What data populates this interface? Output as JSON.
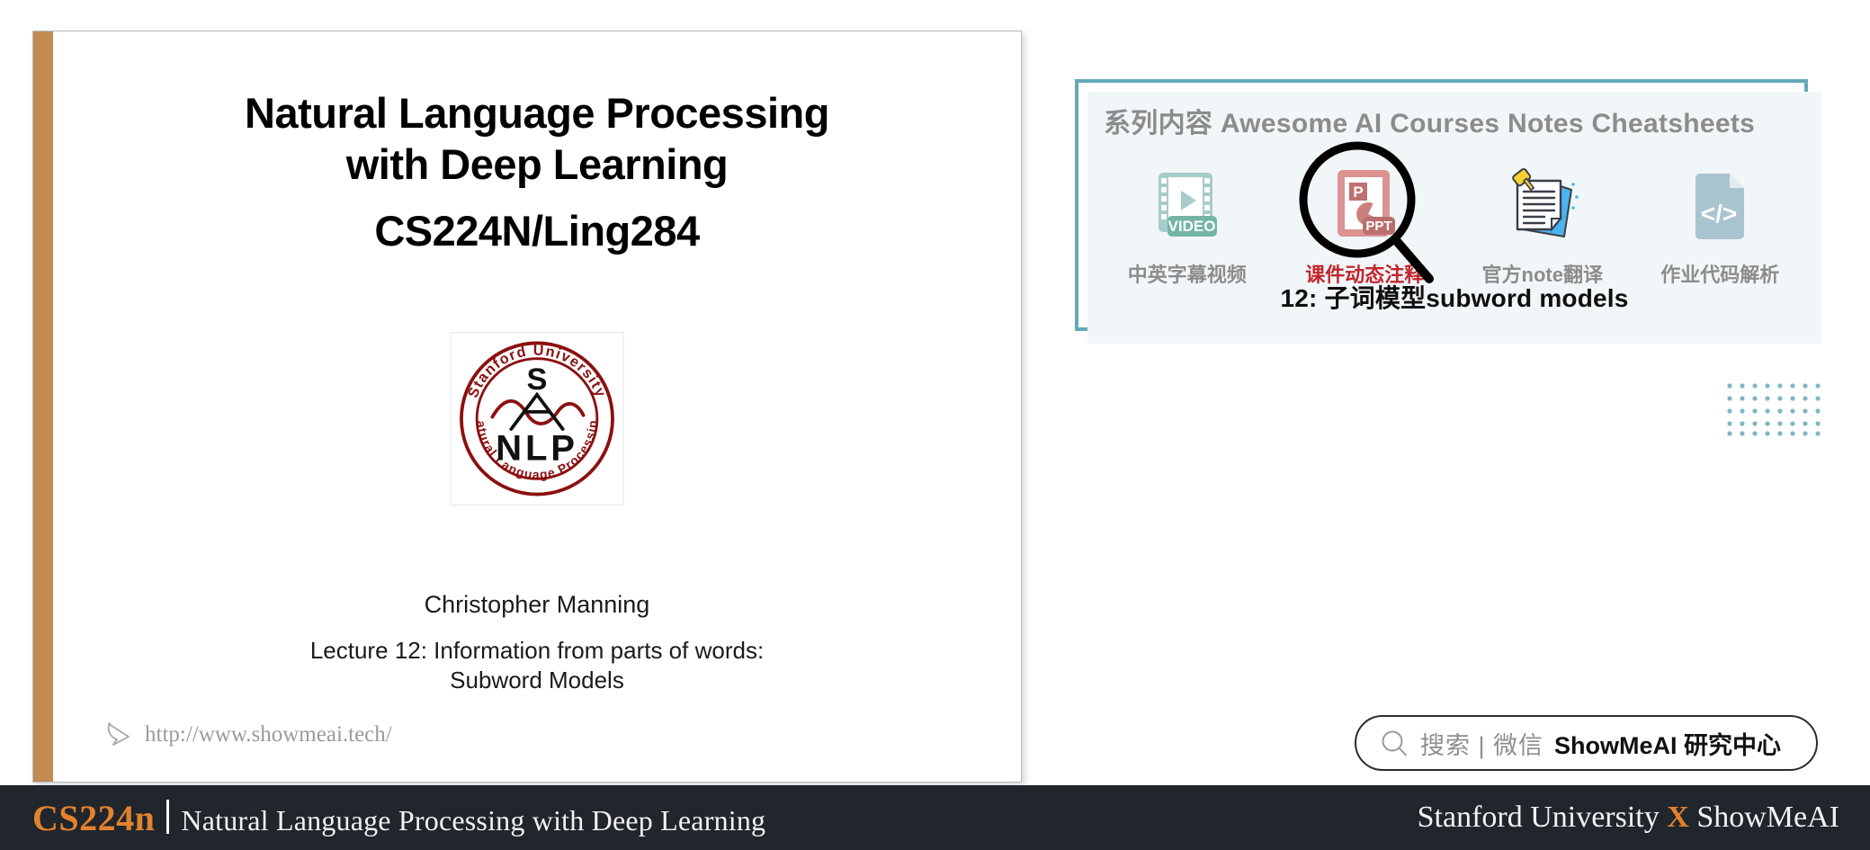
{
  "slide": {
    "title_line1": "Natural Language Processing",
    "title_line2": "with Deep Learning",
    "title_line3": "CS224N/Ling284",
    "logo": {
      "top_arc": "Stanford University",
      "bottom_arc": "Natural Language Processing",
      "letter_s": "S",
      "letters_nlp": "NLP"
    },
    "presenter": "Christopher Manning",
    "lecture_line1": "Lecture 12: Information from parts of words:",
    "lecture_line2": "Subword Models",
    "watermark_url": "http://www.showmeai.tech/",
    "accent_color": "#c38a51"
  },
  "promo": {
    "header": "系列内容 Awesome AI Courses Notes Cheatsheets",
    "border_color": "#62aab8",
    "background_color": "#f1f6f9",
    "items": [
      {
        "label": "中英字幕视频",
        "icon": "video-film-icon",
        "highlighted": false
      },
      {
        "label": "课件动态注释",
        "icon": "ppt-magnifier-icon",
        "highlighted": true
      },
      {
        "label": "官方note翻译",
        "icon": "pinned-note-icon",
        "highlighted": false
      },
      {
        "label": "作业代码解析",
        "icon": "code-file-icon",
        "highlighted": false
      }
    ],
    "icon_badge_video": "VIDEO",
    "icon_badge_ppt": "PPT",
    "icon_letter_ppt": "P",
    "icon_code_glyph": "</>",
    "lecture_title": "12: 子词模型subword models",
    "highlight_color": "#c1272d"
  },
  "search": {
    "prefix": "搜索 | 微信",
    "brand": "ShowMeAI 研究中心",
    "icon": "search-icon"
  },
  "footer": {
    "course_code": "CS224n",
    "subtitle": "Natural Language Processing with Deep Learning",
    "affiliation_left": "Stanford University",
    "affiliation_x": "X",
    "affiliation_right": "ShowMeAI",
    "background_color": "#21252c",
    "accent_color": "#e2822e"
  }
}
